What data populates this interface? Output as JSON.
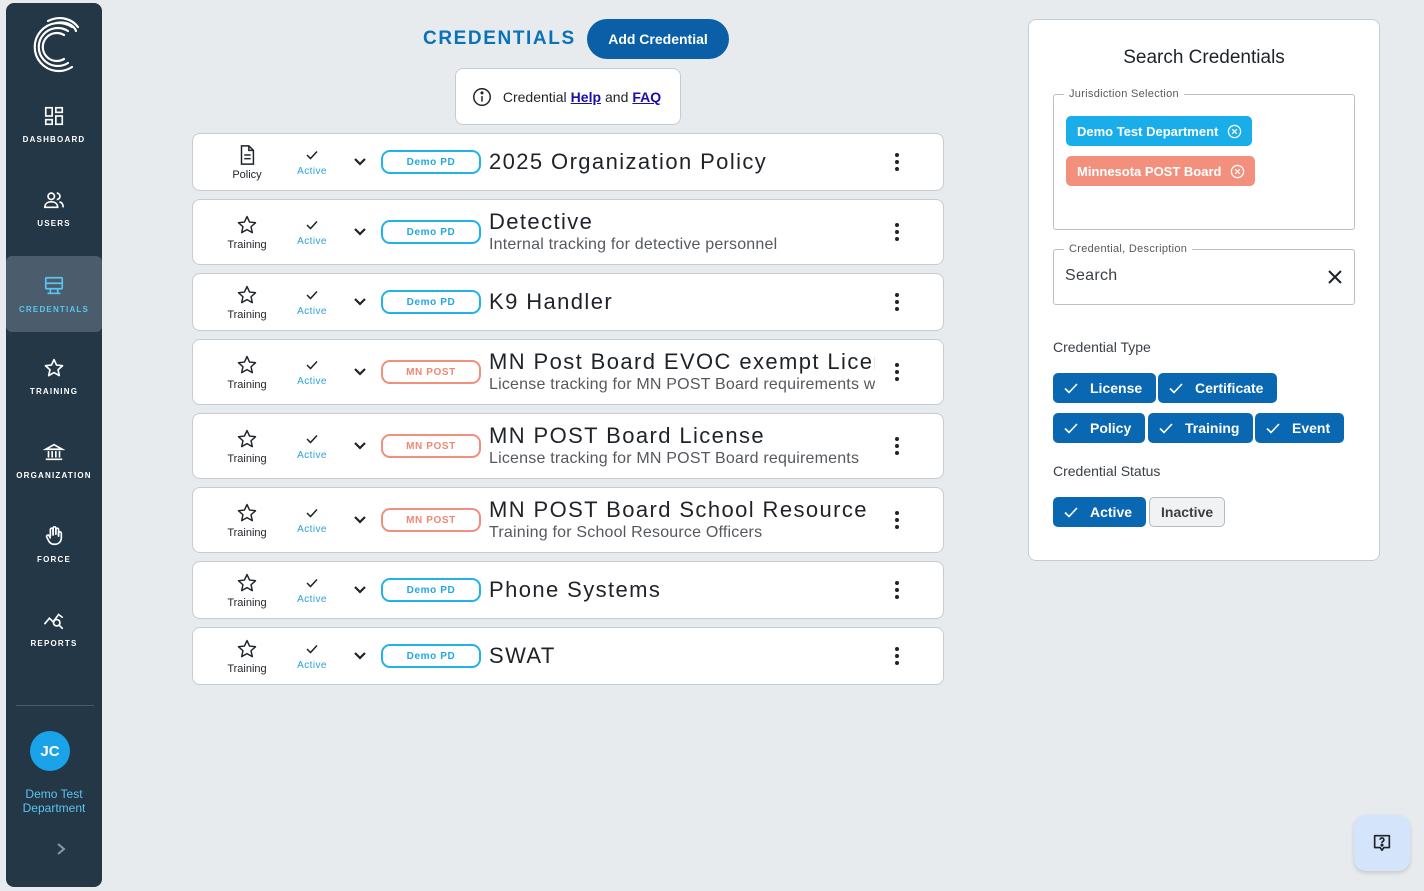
{
  "sidebar": {
    "logo_icon": "company-c-logo",
    "items": [
      {
        "label": "DASHBOARD",
        "icon": "dashboard-icon",
        "active": false
      },
      {
        "label": "USERS",
        "icon": "users-icon",
        "active": false
      },
      {
        "label": "CREDENTIALS",
        "icon": "credentials-icon",
        "active": true
      },
      {
        "label": "TRAINING",
        "icon": "star-icon",
        "active": false
      },
      {
        "label": "ORGANIZATION",
        "icon": "building-icon",
        "active": false
      },
      {
        "label": "FORCE",
        "icon": "hand-icon",
        "active": false
      },
      {
        "label": "REPORTS",
        "icon": "reports-icon",
        "active": false
      }
    ],
    "user_initials": "JC",
    "department": "Demo Test Department"
  },
  "header": {
    "title": "CREDENTIALS",
    "add_button": "Add Credential"
  },
  "help_box": {
    "prefix": "Credential",
    "help_link": "Help",
    "joiner": "and",
    "faq_link": "FAQ"
  },
  "credentials": [
    {
      "type": "Policy",
      "status": "Active",
      "badge": "Demo PD",
      "title": "2025 Organization Policy",
      "description": ""
    },
    {
      "type": "Training",
      "status": "Active",
      "badge": "Demo PD",
      "title": "Detective",
      "description": "Internal tracking for detective personnel"
    },
    {
      "type": "Training",
      "status": "Active",
      "badge": "Demo PD",
      "title": "K9 Handler",
      "description": ""
    },
    {
      "type": "Training",
      "status": "Active",
      "badge": "MN POST",
      "title": "MN Post Board EVOC exempt License",
      "description": "License tracking for MN POST Board requirements with EVOC exemption"
    },
    {
      "type": "Training",
      "status": "Active",
      "badge": "MN POST",
      "title": "MN POST Board License",
      "description": "License tracking for MN POST Board requirements"
    },
    {
      "type": "Training",
      "status": "Active",
      "badge": "MN POST",
      "title": "MN POST Board School Resource",
      "description": "Training for School Resource Officers"
    },
    {
      "type": "Training",
      "status": "Active",
      "badge": "Demo PD",
      "title": "Phone Systems",
      "description": ""
    },
    {
      "type": "Training",
      "status": "Active",
      "badge": "Demo PD",
      "title": "SWAT",
      "description": ""
    }
  ],
  "search_panel": {
    "title": "Search Credentials",
    "jurisdiction_legend": "Jurisdiction Selection",
    "jurisdictions": [
      "Demo Test Department",
      "Minnesota POST Board"
    ],
    "search_legend": "Credential, Description",
    "search_placeholder": "Search",
    "type_label": "Credential Type",
    "types": [
      {
        "label": "License",
        "selected": true
      },
      {
        "label": "Certificate",
        "selected": true
      },
      {
        "label": "Policy",
        "selected": true
      },
      {
        "label": "Training",
        "selected": true
      },
      {
        "label": "Event",
        "selected": true
      }
    ],
    "status_label": "Credential Status",
    "statuses": [
      {
        "label": "Active",
        "selected": true
      },
      {
        "label": "Inactive",
        "selected": false
      }
    ]
  },
  "colors": {
    "sidebar_bg": "#243746",
    "primary": "#0a5fa6",
    "demo_pd": "#20b2e8",
    "mn_post": "#f08f7c"
  }
}
